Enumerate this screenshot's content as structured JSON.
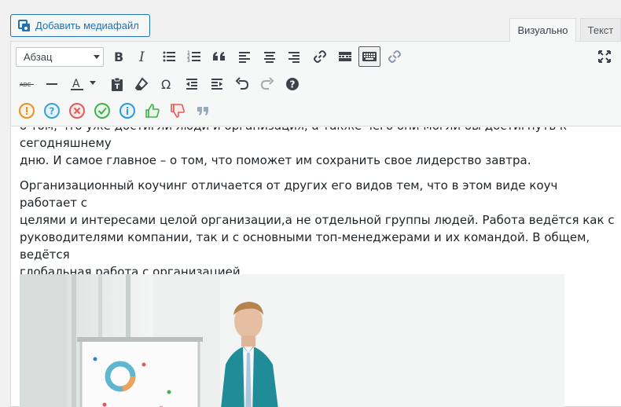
{
  "header": {
    "add_media_label": "Добавить медиафайл",
    "tabs": [
      {
        "label": "Визуально",
        "active": true
      },
      {
        "label": "Текст",
        "active": false
      }
    ]
  },
  "toolbar": {
    "format_select": {
      "value": "Абзац"
    },
    "row1": [
      "bold",
      "italic",
      "bulleted-list",
      "numbered-list",
      "blockquote",
      "align-left",
      "align-center",
      "align-right",
      "link",
      "read-more",
      "toolbar-toggle",
      "unlink",
      "fullscreen"
    ],
    "row2": [
      "strikethrough",
      "horizontal-line",
      "text-color",
      "paste-as-text",
      "clear-formatting",
      "special-character",
      "outdent",
      "indent",
      "undo",
      "redo",
      "keyboard-shortcuts"
    ],
    "row3": [
      "alert",
      "help",
      "error",
      "success",
      "info",
      "thumbs-up",
      "thumbs-down",
      "quote"
    ],
    "colors": {
      "alert": "#e9902a",
      "help": "#3aa0d8",
      "error": "#e25b5b",
      "success": "#3fb24b",
      "info": "#2b9ad6",
      "thumbs_up": "#3fb24b",
      "thumbs_down": "#e25b5b",
      "quote": "#9aa8c2"
    }
  },
  "content": {
    "paragraph_0_line_1": "о том, что уже достигли люди и организация, а также чего они могли бы достигнуть к сегодняшнему",
    "paragraph_0_line_2": "дню. И самое главное – о том, что поможет им сохранить свое лидерство завтра.",
    "paragraph_1_line_1": "Организационный коучинг отличается от других его видов тем, что в этом виде коуч работает с",
    "paragraph_1_line_2": "целями и интересами целой организации,а не отдельной группы людей. Работа ведётся как с",
    "paragraph_1_line_3": "руководителями компании, так и с основными топ-менеджерами и их командой. В общем, ведётся",
    "paragraph_1_line_4": "глобальная работа с организацией."
  }
}
